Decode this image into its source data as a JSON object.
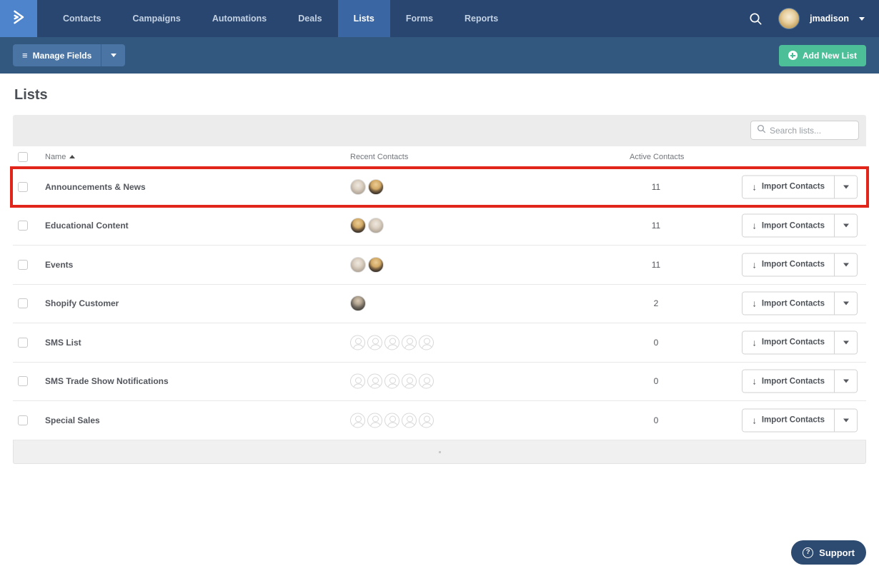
{
  "nav": {
    "items": [
      {
        "label": "Contacts",
        "active": false
      },
      {
        "label": "Campaigns",
        "active": false
      },
      {
        "label": "Automations",
        "active": false
      },
      {
        "label": "Deals",
        "active": false
      },
      {
        "label": "Lists",
        "active": true
      },
      {
        "label": "Forms",
        "active": false
      },
      {
        "label": "Reports",
        "active": false
      }
    ],
    "username": "jmadison"
  },
  "toolbar": {
    "manage_fields": "Manage Fields",
    "add_new_list": "Add New List"
  },
  "page": {
    "title": "Lists"
  },
  "search": {
    "placeholder": "Search lists..."
  },
  "table": {
    "columns": {
      "name": "Name",
      "recent": "Recent Contacts",
      "active": "Active Contacts"
    },
    "sort": {
      "column": "Name",
      "direction": "ascending"
    },
    "import_label": "Import Contacts",
    "rows": [
      {
        "name": "Announcements & News",
        "active_contacts": "11",
        "avatars": [
          "gray-haired-woman",
          "blonde-woman"
        ],
        "placeholders": 0,
        "highlighted": true
      },
      {
        "name": "Educational Content",
        "active_contacts": "11",
        "avatars": [
          "blonde-woman",
          "gray-haired-woman"
        ],
        "placeholders": 0,
        "highlighted": false
      },
      {
        "name": "Events",
        "active_contacts": "11",
        "avatars": [
          "gray-haired-woman",
          "blonde-woman"
        ],
        "placeholders": 0,
        "highlighted": false
      },
      {
        "name": "Shopify Customer",
        "active_contacts": "2",
        "avatars": [
          "man-with-glasses"
        ],
        "placeholders": 0,
        "highlighted": false
      },
      {
        "name": "SMS List",
        "active_contacts": "0",
        "avatars": [],
        "placeholders": 5,
        "highlighted": false
      },
      {
        "name": "SMS Trade Show Notifications",
        "active_contacts": "0",
        "avatars": [],
        "placeholders": 5,
        "highlighted": false
      },
      {
        "name": "Special Sales",
        "active_contacts": "0",
        "avatars": [],
        "placeholders": 5,
        "highlighted": false
      }
    ]
  },
  "support": {
    "label": "Support",
    "icon": "?"
  },
  "icons": {
    "list_glyph": "≡",
    "down_arrow": "↓"
  },
  "colors": {
    "nav_bg": "#28466f",
    "nav_active_bg": "#3a66a3",
    "logo_bg": "#4e84cc",
    "subbar_bg": "#33587f",
    "accent_green": "#4dbf98",
    "highlight_red": "#e1251b",
    "support_navy": "#2d4a71"
  }
}
